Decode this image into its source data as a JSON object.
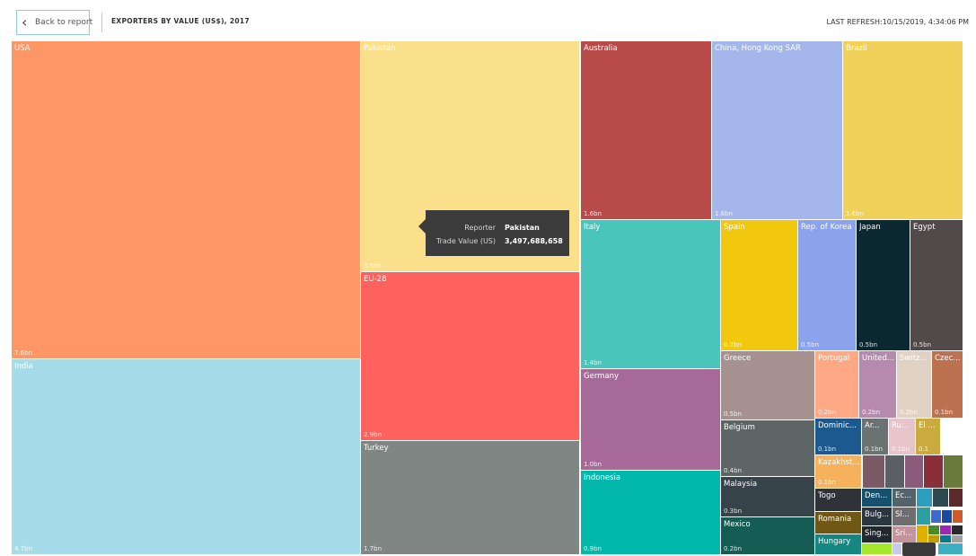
{
  "header": {
    "back_label": "Back to report",
    "back_icon": "chevron-left-icon",
    "title": "EXPORTERS BY VALUE (US$), 2017",
    "refresh": "LAST REFRESH:10/15/2019, 4:34:06 PM"
  },
  "tooltip": {
    "reporter_label": "Reporter",
    "reporter_value": "Pakistan",
    "trade_label": "Trade Value (US)",
    "trade_value": "3,497,688,658"
  },
  "colors": {
    "tooltip_bg": "#3b3b3b",
    "back_border": "#8fc9e6"
  },
  "chart_data": {
    "type": "treemap",
    "value_unit": "bn US$",
    "items": [
      {
        "name": "USA",
        "label": "7.6bn",
        "value": 7.6,
        "color": "#fe9666"
      },
      {
        "name": "India",
        "label": "4.7bn",
        "value": 4.7,
        "color": "#a6dcea"
      },
      {
        "name": "Pakistan",
        "label": "3.5bn",
        "value": 3.5,
        "color": "#fbe08c"
      },
      {
        "name": "EU-28",
        "label": "2.9bn",
        "value": 2.9,
        "color": "#fd625e"
      },
      {
        "name": "Turkey",
        "label": "1.7bn",
        "value": 1.7,
        "color": "#808683"
      },
      {
        "name": "Australia",
        "label": "1.6bn",
        "value": 1.6,
        "color": "#b84a49"
      },
      {
        "name": "China, Hong Kong SAR",
        "label": "1.6bn",
        "value": 1.6,
        "color": "#a5b6ea"
      },
      {
        "name": "Brazil",
        "label": "1.6bn",
        "value": 1.6,
        "color": "#f2d15b"
      },
      {
        "name": "Italy",
        "label": "1.4bn",
        "value": 1.4,
        "color": "#4ac5bb"
      },
      {
        "name": "Germany",
        "label": "1.0bn",
        "value": 1.0,
        "color": "#a66999"
      },
      {
        "name": "Indonesia",
        "label": "0.9bn",
        "value": 0.9,
        "color": "#01b8aa"
      },
      {
        "name": "Spain",
        "label": "0.7bn",
        "value": 0.7,
        "color": "#f2c80f"
      },
      {
        "name": "Rep. of Korea",
        "label": "0.5bn",
        "value": 0.5,
        "color": "#8ba2ec"
      },
      {
        "name": "Japan",
        "label": "0.5bn",
        "value": 0.5,
        "color": "#0b2730"
      },
      {
        "name": "Egypt",
        "label": "0.5bn",
        "value": 0.5,
        "color": "#524a4a"
      },
      {
        "name": "Greece",
        "label": "0.5bn",
        "value": 0.5,
        "color": "#a59190"
      },
      {
        "name": "Belgium",
        "label": "0.4bn",
        "value": 0.4,
        "color": "#5d6565"
      },
      {
        "name": "Malaysia",
        "label": "0.3bn",
        "value": 0.3,
        "color": "#37434a"
      },
      {
        "name": "Mexico",
        "label": "0.2bn",
        "value": 0.2,
        "color": "#155c55"
      },
      {
        "name": "Portugal",
        "label": "0.2bn",
        "value": 0.2,
        "color": "#fea886"
      },
      {
        "name": "United...",
        "label": "0.2bn",
        "value": 0.2,
        "color": "#b68aaf"
      },
      {
        "name": "Switz...",
        "label": "0.2bn",
        "value": 0.2,
        "color": "#e1d3c3"
      },
      {
        "name": "Czec...",
        "label": "0.1bn",
        "value": 0.1,
        "color": "#bc7250"
      },
      {
        "name": "Dominic...",
        "label": "0.1bn",
        "value": 0.1,
        "color": "#1b598e"
      },
      {
        "name": "Ar...",
        "label": "0.1bn",
        "value": 0.1,
        "color": "#6a7272"
      },
      {
        "name": "Ru...",
        "label": "0.1bn",
        "value": 0.1,
        "color": "#e7c3ca"
      },
      {
        "name": "El ...",
        "label": "0.1",
        "value": 0.1,
        "color": "#c9ac3d"
      },
      {
        "name": "Kazakhst...",
        "label": "0.1bn",
        "value": 0.1,
        "color": "#f6b15c"
      },
      {
        "name": "Togo",
        "label": "",
        "value": 0.1,
        "color": "#2f3236"
      },
      {
        "name": "Romania",
        "label": "",
        "value": 0.1,
        "color": "#6f5716"
      },
      {
        "name": "Hungary",
        "label": "",
        "value": 0.1,
        "color": "#168780"
      },
      {
        "name": "Den...",
        "label": "",
        "value": 0.05,
        "color": "#15506c"
      },
      {
        "name": "Ec...",
        "label": "",
        "value": 0.05,
        "color": "#54626a"
      },
      {
        "name": "Bulg...",
        "label": "",
        "value": 0.05,
        "color": "#2a3740"
      },
      {
        "name": "Sl...",
        "label": "",
        "value": 0.05,
        "color": "#6e6e6e"
      },
      {
        "name": "Sing...",
        "label": "",
        "value": 0.05,
        "color": "#22292e"
      },
      {
        "name": "Sri...",
        "label": "",
        "value": 0.05,
        "color": "#c2949c"
      }
    ]
  }
}
